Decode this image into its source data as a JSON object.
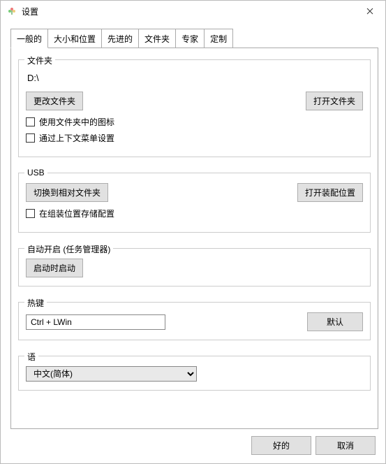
{
  "title": "设置",
  "tabs": [
    "一般的",
    "大小和位置",
    "先进的",
    "文件夹",
    "专家",
    "定制"
  ],
  "group_folder": {
    "label": "文件夹",
    "path": "D:\\",
    "change_btn": "更改文件夹",
    "open_btn": "打开文件夹",
    "use_icons": "使用文件夹中的图标",
    "via_context": "通过上下文菜单设置"
  },
  "group_usb": {
    "label": "USB",
    "switch_btn": "切换到相对文件夹",
    "open_loc_btn": "打开装配位置",
    "store_config": "在组装位置存储配置"
  },
  "group_autostart": {
    "label": "自动开启 (任务管理器)",
    "toggle_btn": "启动时启动"
  },
  "group_hotkey": {
    "label": "热键",
    "value": "Ctrl + LWin",
    "default_btn": "默认"
  },
  "group_lang": {
    "label": "语",
    "value": "中文(简体)"
  },
  "footer": {
    "ok": "好的",
    "cancel": "取消"
  }
}
